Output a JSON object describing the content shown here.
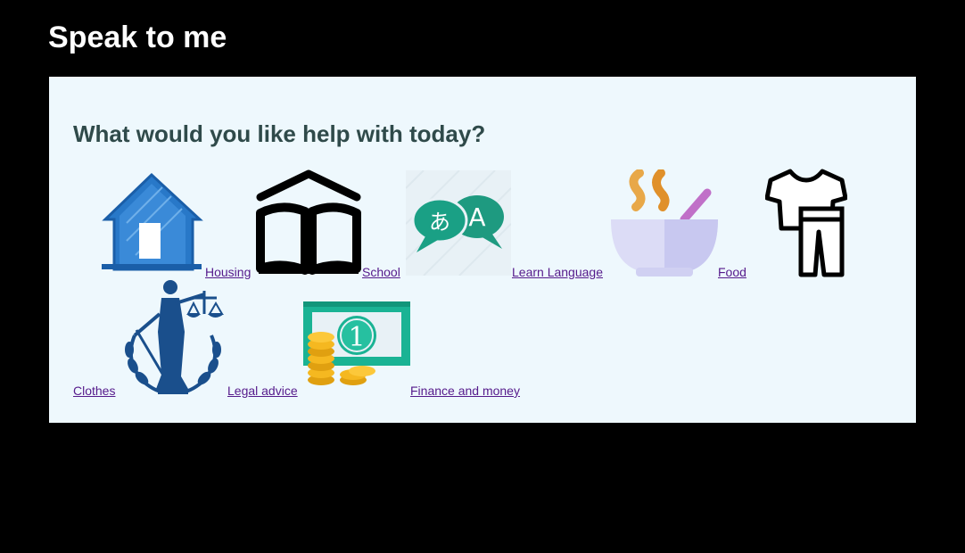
{
  "header": {
    "title": "Speak to me"
  },
  "main": {
    "heading": "What would you like help with today?",
    "links": [
      {
        "label": "Housing",
        "icon": "house-icon"
      },
      {
        "label": "School",
        "icon": "open-book-icon"
      },
      {
        "label": "Learn Language",
        "icon": "translate-icon"
      },
      {
        "label": "Food",
        "icon": "soup-bowl-icon"
      },
      {
        "label": "Clothes",
        "icon": "clothes-icon"
      },
      {
        "label": "Legal advice",
        "icon": "lady-justice-icon"
      },
      {
        "label": "Finance and money",
        "icon": "money-icon"
      }
    ]
  },
  "colors": {
    "page_background": "#000000",
    "panel_background": "#eef8fd",
    "heading_text": "#2f4a4a",
    "link_text": "#551a8b"
  }
}
